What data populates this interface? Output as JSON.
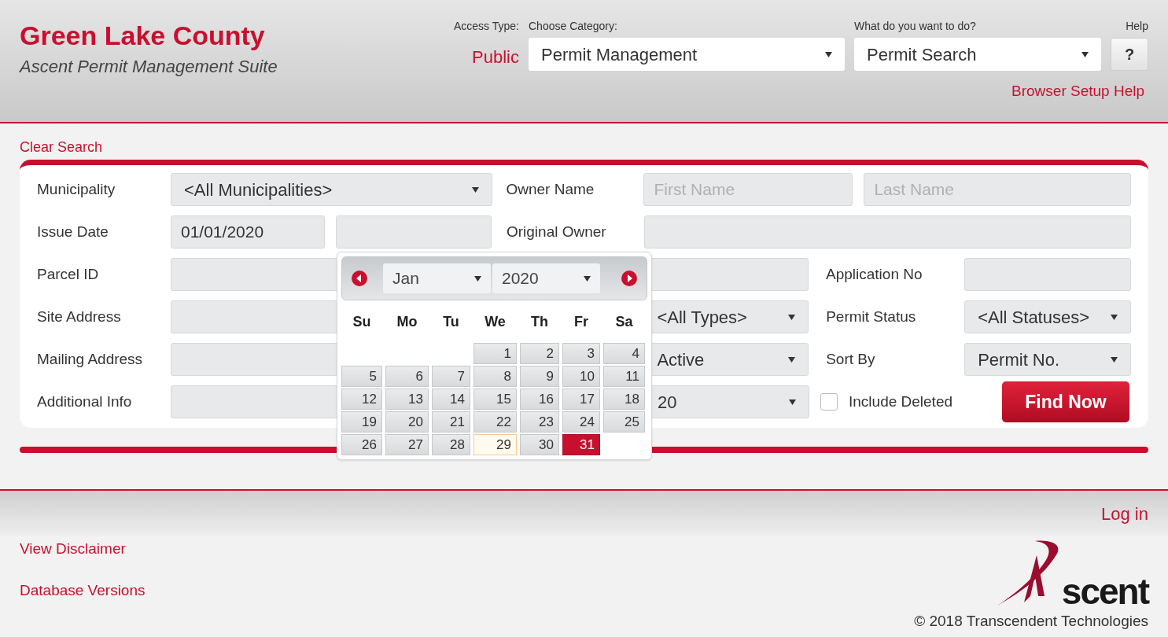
{
  "header": {
    "title": "Green Lake County",
    "subtitle": "Ascent Permit Management Suite",
    "access_type": {
      "label": "Access Type:",
      "value": "Public"
    },
    "category": {
      "label": "Choose Category:",
      "value": "Permit Management"
    },
    "action": {
      "label": "What do you want to do?",
      "value": "Permit Search"
    },
    "help": {
      "label": "Help",
      "button": "?"
    },
    "browser_help": "Browser Setup Help"
  },
  "clear_search": "Clear Search",
  "form": {
    "municipality": {
      "label": "Municipality",
      "value": "<All Municipalities>"
    },
    "owner_name": {
      "label": "Owner Name",
      "first_placeholder": "First Name",
      "last_placeholder": "Last Name"
    },
    "issue_date": {
      "label": "Issue Date",
      "from_value": "01/01/2020"
    },
    "original_owner": {
      "label": "Original Owner"
    },
    "parcel_id": {
      "label": "Parcel ID"
    },
    "application_no": {
      "label": "Application No"
    },
    "site_address": {
      "label": "Site Address"
    },
    "type_select": {
      "value": "<All Types>"
    },
    "permit_status": {
      "label": "Permit Status",
      "value": "<All Statuses>"
    },
    "mailing_address": {
      "label": "Mailing Address"
    },
    "active_select": {
      "value": "Active"
    },
    "sort_by": {
      "label": "Sort By",
      "value": "Permit No."
    },
    "additional_info": {
      "label": "Additional Info"
    },
    "count_select": {
      "value": "20"
    },
    "include_deleted": {
      "label": "Include Deleted",
      "checked": false
    },
    "find_button": "Find Now"
  },
  "calendar": {
    "month": "Jan",
    "year": "2020",
    "weekdays": [
      "Su",
      "Mo",
      "Tu",
      "We",
      "Th",
      "Fr",
      "Sa"
    ],
    "weeks": [
      [
        {
          "label": "1",
          "selected": false,
          "today": false
        },
        {
          "label": "2",
          "selected": false,
          "today": false
        },
        {
          "label": "3",
          "selected": false,
          "today": false
        },
        {
          "label": "4",
          "selected": false,
          "today": false
        }
      ],
      [
        {
          "label": "5",
          "selected": false,
          "today": false
        },
        {
          "label": "6",
          "selected": false,
          "today": false
        },
        {
          "label": "7",
          "selected": false,
          "today": false
        },
        {
          "label": "8",
          "selected": false,
          "today": false
        },
        {
          "label": "9",
          "selected": false,
          "today": false
        },
        {
          "label": "10",
          "selected": false,
          "today": false
        },
        {
          "label": "11",
          "selected": false,
          "today": false
        }
      ],
      [
        {
          "label": "12",
          "selected": false,
          "today": false
        },
        {
          "label": "13",
          "selected": false,
          "today": false
        },
        {
          "label": "14",
          "selected": false,
          "today": false
        },
        {
          "label": "15",
          "selected": false,
          "today": false
        },
        {
          "label": "16",
          "selected": false,
          "today": false
        },
        {
          "label": "17",
          "selected": false,
          "today": false
        },
        {
          "label": "18",
          "selected": false,
          "today": false
        }
      ],
      [
        {
          "label": "19",
          "selected": false,
          "today": false
        },
        {
          "label": "20",
          "selected": false,
          "today": false
        },
        {
          "label": "21",
          "selected": false,
          "today": false
        },
        {
          "label": "22",
          "selected": false,
          "today": false
        },
        {
          "label": "23",
          "selected": false,
          "today": false
        },
        {
          "label": "24",
          "selected": false,
          "today": false
        },
        {
          "label": "25",
          "selected": false,
          "today": false
        }
      ],
      [
        {
          "label": "26",
          "selected": false,
          "today": false
        },
        {
          "label": "27",
          "selected": false,
          "today": false
        },
        {
          "label": "28",
          "selected": false,
          "today": false
        },
        {
          "label": "29",
          "selected": false,
          "today": true
        },
        {
          "label": "30",
          "selected": false,
          "today": false
        },
        {
          "label": "31",
          "selected": true,
          "today": false
        }
      ]
    ]
  },
  "footer": {
    "login": "Log in",
    "links": [
      "View Disclaimer",
      "Database Versions"
    ],
    "logo_text": "scent",
    "copyright": "© 2018 Transcendent Technologies"
  }
}
